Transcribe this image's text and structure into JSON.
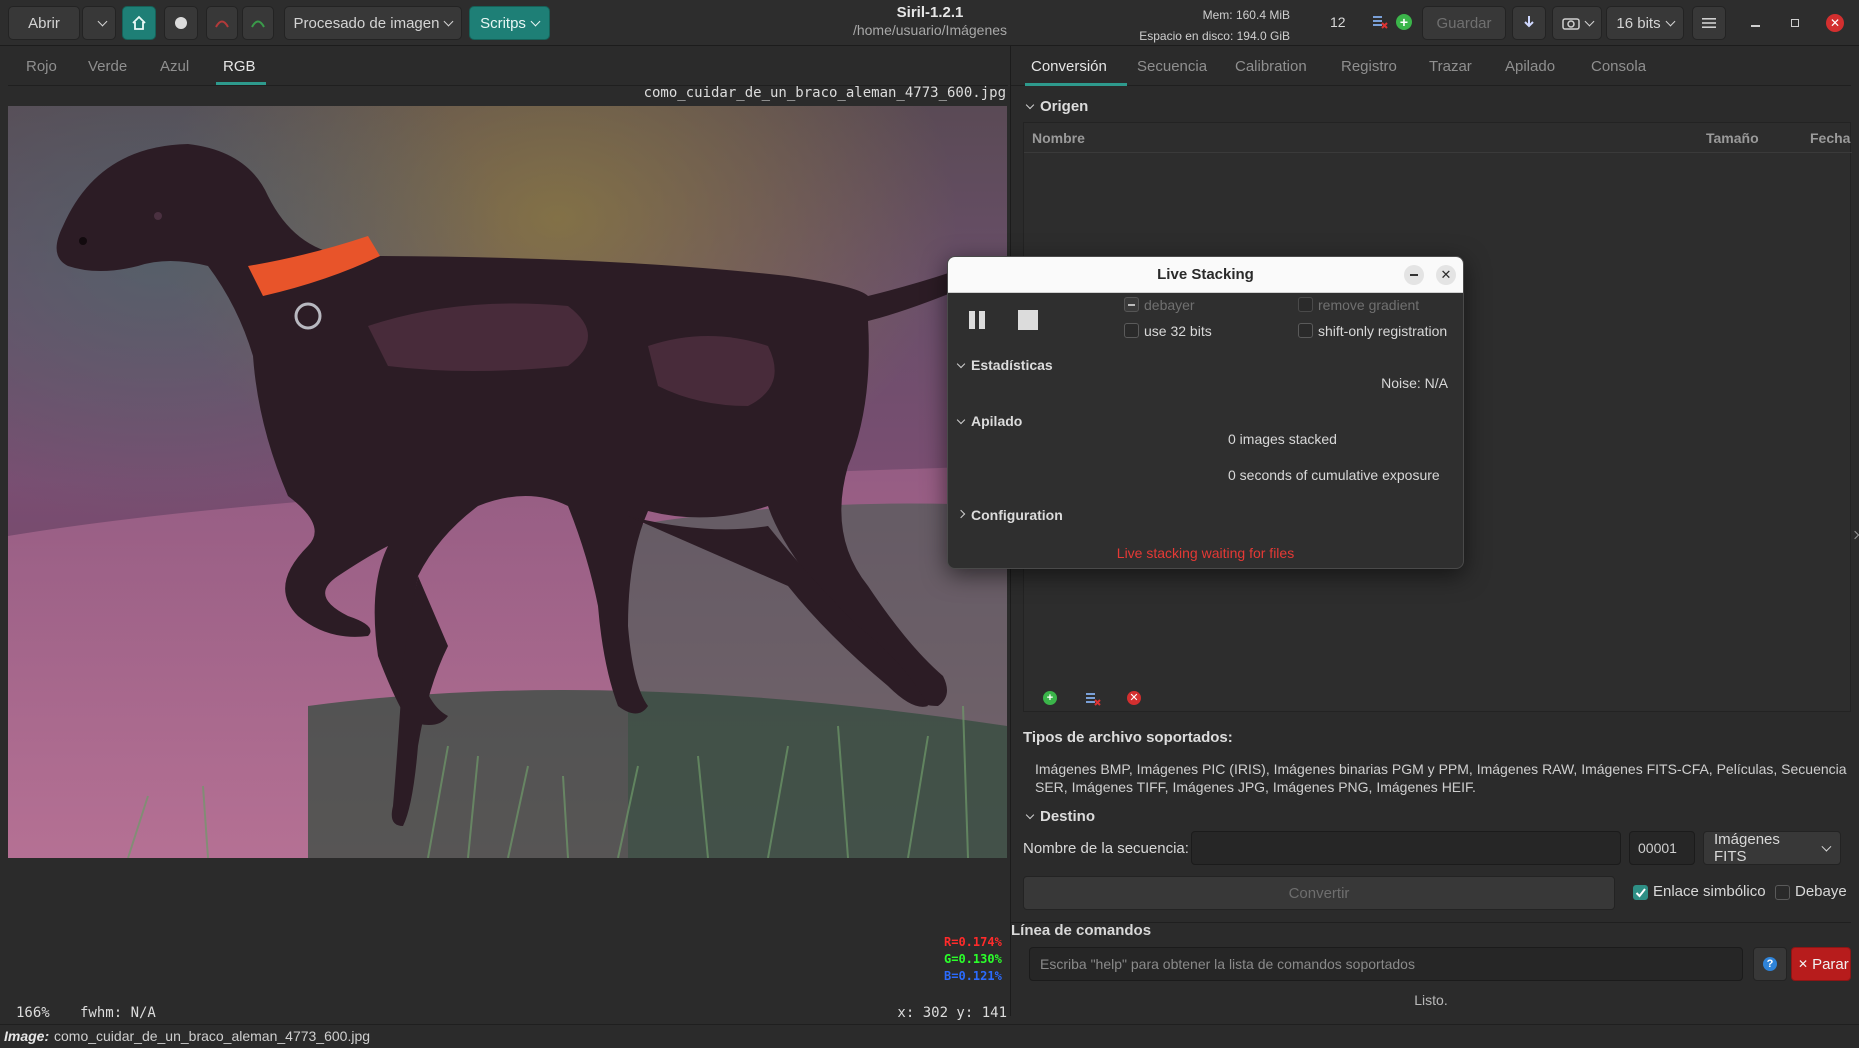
{
  "header": {
    "open_label": "Abrir",
    "image_processing_label": "Procesado de imagen",
    "scripts_label": "Scritps",
    "app_title": "Siril-1.2.1",
    "app_subtitle": "/home/usuario/Imágenes",
    "mem_label": "Mem: 160.4 MiB",
    "disk_label": "Espacio en disco: 194.0 GiB",
    "threads_value": "12",
    "save_label": "Guardar",
    "bits_label": "16 bits"
  },
  "left": {
    "tabs": [
      "Rojo",
      "Verde",
      "Azul",
      "RGB"
    ],
    "active_tab": "RGB",
    "filename": "como_cuidar_de_un_braco_aleman_4773_600.jpg",
    "rgb": {
      "r": "R=0.174%",
      "g": "G=0.130%",
      "b": "B=0.121%"
    },
    "zoom": "166%",
    "fwhm": "fwhm: N/A",
    "coords": "x: 302 y: 141"
  },
  "statusbar": {
    "image_prefix": "Image:",
    "image_name": "como_cuidar_de_un_braco_aleman_4773_600.jpg"
  },
  "right": {
    "tabs": [
      "Conversión",
      "Secuencia",
      "Calibration",
      "Registro",
      "Trazar",
      "Apilado",
      "Consola"
    ],
    "active_tab": "Conversión",
    "source_section": "Origen",
    "columns": {
      "name": "Nombre",
      "size": "Tamaño",
      "date": "Fecha"
    },
    "supported_title": "Tipos de archivo soportados:",
    "supported_line1": "Imágenes BMP, Imágenes PIC (IRIS), Imágenes binarias PGM y PPM, Imágenes RAW, Imágenes FITS-CFA, Películas, Secuencia",
    "supported_line2": "SER, Imágenes TIFF, Imágenes JPG, Imágenes PNG, Imágenes HEIF.",
    "dest_section": "Destino",
    "seq_name_label": "Nombre de la secuencia:",
    "seq_name_value": "",
    "start_index": "00001",
    "output_format": "Imágenes FITS",
    "convert_label": "Convertir",
    "symlink_label": "Enlace simbólico",
    "symlink_checked": true,
    "debayer_label": "Debaye",
    "cmd_title": "Línea de comandos",
    "cmd_placeholder": "Escriba \"help\" para obtener la lista de comandos soportados",
    "stop_label": "Parar",
    "status": "Listo."
  },
  "dialog": {
    "title": "Live Stacking",
    "debayer_label": "debayer",
    "remove_gradient_label": "remove gradient",
    "use32_label": "use 32 bits",
    "shift_only_label": "shift-only registration",
    "stats_section": "Estadísticas",
    "noise": "Noise: N/A",
    "stacking_section": "Apilado",
    "images_stacked": "0 images stacked",
    "exposure": "0 seconds of cumulative exposure",
    "config_section": "Configuration",
    "status": "Live stacking waiting for files",
    "status_color": "#e53935"
  },
  "colors": {
    "accent": "#1e7f76",
    "stop_button": "#b71c1c",
    "add_icon": "#3bb54a",
    "remove_icon": "#d32f2f"
  }
}
